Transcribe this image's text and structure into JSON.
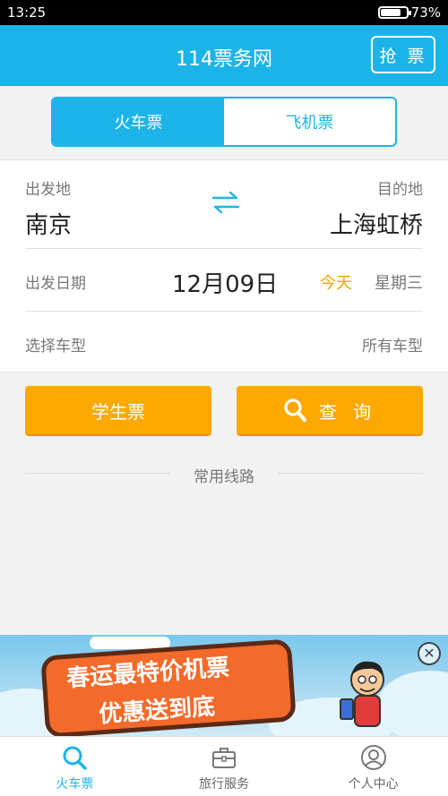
{
  "status_bar": {
    "time": "13:25",
    "battery": "73%",
    "battery_level": 0.73
  },
  "header": {
    "title": "114票务网",
    "grab_button": "抢 票"
  },
  "ticket_tabs": [
    {
      "label": "火车票",
      "active": true
    },
    {
      "label": "飞机票",
      "active": false
    }
  ],
  "form": {
    "from_label": "出发地",
    "to_label": "目的地",
    "from_city": "南京",
    "to_city": "上海虹桥",
    "date_label": "出发日期",
    "date": "12月09日",
    "today": "今天",
    "weekday": "星期三",
    "train_type_label": "选择车型",
    "train_type_value": "所有车型"
  },
  "buttons": {
    "student": "学生票",
    "query": "查 询"
  },
  "routes_title": "常用线路",
  "banner": {
    "line1": "春运最特价机票",
    "line2": "优惠送到底",
    "close": "✕"
  },
  "tabbar": [
    {
      "label": "火车票",
      "icon": "search-icon",
      "active": true
    },
    {
      "label": "旅行服务",
      "icon": "briefcase-icon",
      "active": false
    },
    {
      "label": "个人中心",
      "icon": "user-icon",
      "active": false
    }
  ],
  "colors": {
    "primary": "#1cb4e8",
    "accent": "#ffa800",
    "today": "#f5a30a"
  }
}
